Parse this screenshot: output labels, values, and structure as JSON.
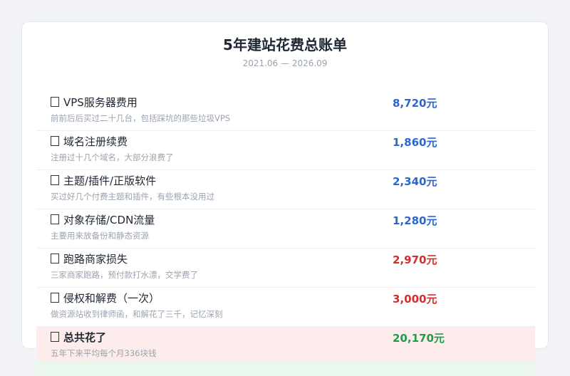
{
  "header": {
    "title": "5年建站花费总账单",
    "period": "2021.06 — 2026.09"
  },
  "colors": {
    "blue": "#2a66d6",
    "red": "#d32f2f",
    "green": "#1e9e4a",
    "total_bg": "#fdecec"
  },
  "items": [
    {
      "icon": "money-icon",
      "name": "VPS服务器费用",
      "desc": "前前后后买过二十几台，包括踩坑的那些垃圾VPS",
      "amount": "8,720元"
    },
    {
      "icon": "globe-icon",
      "name": "域名注册续费",
      "desc": "注册过十几个域名，大部分浪费了",
      "amount": "1,860元"
    },
    {
      "icon": "puzzle-icon",
      "name": "主题/插件/正版软件",
      "desc": "买过好几个付费主题和插件，有些根本没用过",
      "amount": "2,340元"
    },
    {
      "icon": "storage-icon",
      "name": "对象存储/CDN流量",
      "desc": "主要用来放备份和静态资源",
      "amount": "1,280元"
    },
    {
      "icon": "runaway-icon",
      "name": "跑路商家损失",
      "desc": "三家商家跑路，预付款打水漂，交学费了",
      "amount": "2,970元"
    },
    {
      "icon": "legal-icon",
      "name": "侵权和解费（一次）",
      "desc": "做资源站收到律师函，和解花了三千，记忆深刻",
      "amount": "3,000元"
    }
  ],
  "total": {
    "icon": "sum-icon",
    "name": "总共花了",
    "desc": "五年下来平均每个月336块钱",
    "amount": "20,170元"
  }
}
